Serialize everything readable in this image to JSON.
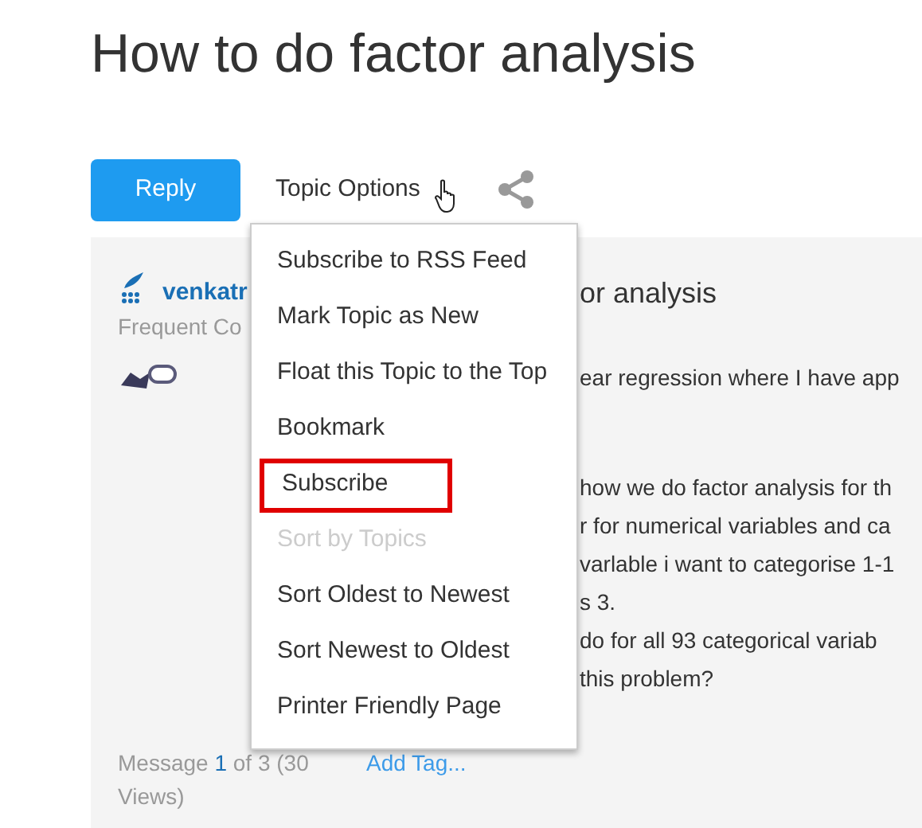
{
  "page_title": "How to do factor analysis",
  "toolbar": {
    "reply_button": "Reply",
    "topic_options": "Topic Options"
  },
  "menu": {
    "items": [
      {
        "label": "Subscribe to RSS Feed",
        "disabled": false,
        "highlighted": false
      },
      {
        "label": "Mark Topic as New",
        "disabled": false,
        "highlighted": false
      },
      {
        "label": "Float this Topic to the Top",
        "disabled": false,
        "highlighted": false
      },
      {
        "label": "Bookmark",
        "disabled": false,
        "highlighted": false
      },
      {
        "label": "Subscribe",
        "disabled": false,
        "highlighted": true
      },
      {
        "label": "Sort by Topics",
        "disabled": true,
        "highlighted": false
      },
      {
        "label": "Sort Oldest to Newest",
        "disabled": false,
        "highlighted": false
      },
      {
        "label": "Sort Newest to Oldest",
        "disabled": false,
        "highlighted": false
      },
      {
        "label": "Printer Friendly Page",
        "disabled": false,
        "highlighted": false
      }
    ]
  },
  "post": {
    "author": "venkatr",
    "rank": "Frequent Co",
    "heading": "or analysis",
    "paragraphs": [
      [
        "ear regression where I have app"
      ],
      [
        "how we do factor analysis for th",
        "r for numerical variables  and ca",
        "varlable i want to categorise 1-1",
        "s 3.",
        "do  for all 93 categorical variab",
        "this problem?"
      ]
    ],
    "message_prefix": "Message ",
    "message_number": "1",
    "message_suffix": " of 3 (30 Views)",
    "add_tag": "Add Tag..."
  }
}
